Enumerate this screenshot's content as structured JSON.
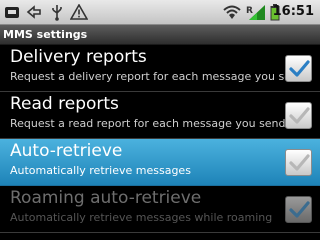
{
  "status_bar": {
    "time": "16:51",
    "icons": [
      "usb-icon",
      "sync-icon",
      "usb-debugging-icon",
      "warning-icon",
      "wifi-icon",
      "signal-roaming-icon",
      "battery-icon"
    ]
  },
  "title_bar": {
    "title": "MMS settings"
  },
  "settings": [
    {
      "title": "Delivery reports",
      "summary": "Request a delivery report for each message you send",
      "checked": true,
      "state": "normal"
    },
    {
      "title": "Read reports",
      "summary": "Request a read report for each message you send",
      "checked": false,
      "state": "normal"
    },
    {
      "title": "Auto-retrieve",
      "summary": "Automatically retrieve messages",
      "checked": false,
      "state": "selected"
    },
    {
      "title": "Roaming auto-retrieve",
      "summary": "Automatically retrieve messages while roaming",
      "checked": true,
      "state": "disabled"
    }
  ],
  "colors": {
    "selection": "#33a0d2",
    "check_blue": "#2b7fc4",
    "check_gray": "#b7b7b7"
  }
}
